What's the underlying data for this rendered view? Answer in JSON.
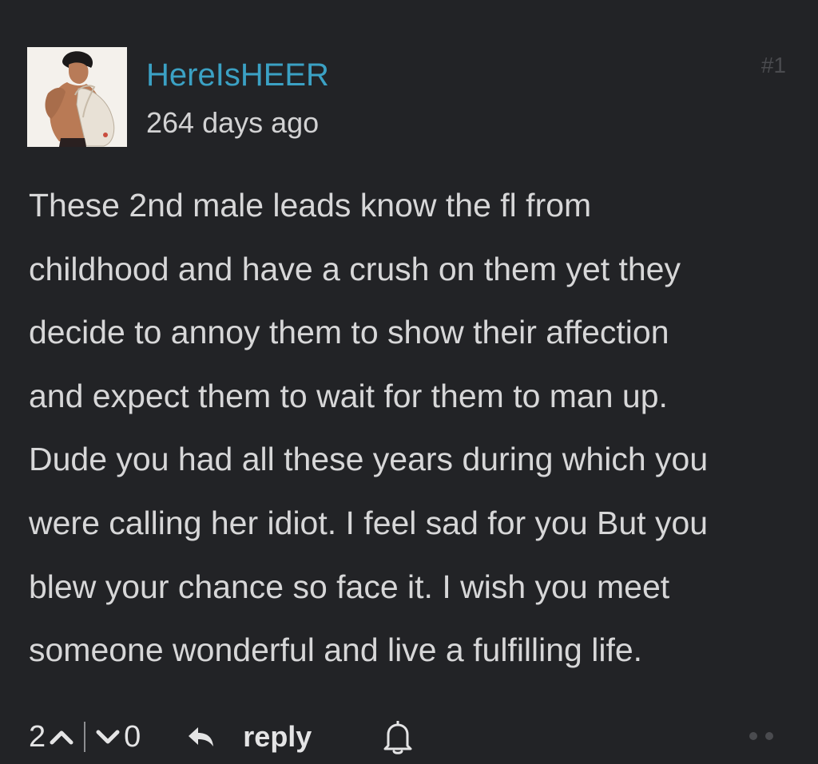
{
  "comment": {
    "username": "HereIsHEER",
    "timestamp": "264 days ago",
    "number": "#1",
    "body_lines": [
      "These 2nd male leads know the fl from",
      "childhood and have a crush on them yet they",
      "decide to annoy them to show their affection",
      "and expect them to wait for them to man up.",
      "Dude you had all these years during which you",
      "were calling her idiot. I feel sad for you But you",
      "blew your chance so face it. I wish you meet",
      "someone wonderful and live a fulfilling life."
    ]
  },
  "actions": {
    "upvotes": "2",
    "downvotes": "0",
    "reply_label": "reply",
    "icons": [
      "chevron-up-icon",
      "chevron-down-icon",
      "reply-arrow-icon",
      "bell-icon",
      "more-dots-icon"
    ]
  },
  "colors": {
    "background": "#222326",
    "username": "#3ba1c4",
    "text": "#d7d7d8",
    "muted": "#4a4b4f"
  }
}
